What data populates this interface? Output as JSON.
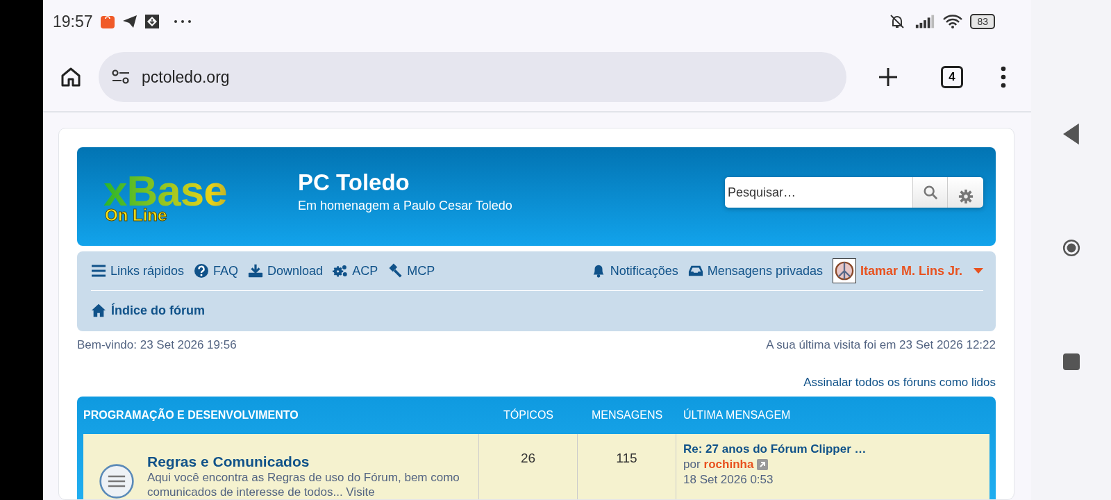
{
  "status_bar": {
    "time": "19:57",
    "battery": "83"
  },
  "browser": {
    "url": "pctoledo.org",
    "tab_count": "4"
  },
  "header": {
    "logo_main": "xBase",
    "logo_sub": "On Line",
    "site_title": "PC Toledo",
    "site_description": "Em homenagem a Paulo Cesar Toledo",
    "search": {
      "placeholder": "Pesquisar…"
    }
  },
  "nav": {
    "left": [
      {
        "label": "Links rápidos"
      },
      {
        "label": "FAQ"
      },
      {
        "label": "Download"
      },
      {
        "label": "ACP"
      },
      {
        "label": "MCP"
      }
    ],
    "right": [
      {
        "label": "Notificações"
      },
      {
        "label": "Mensagens privadas"
      }
    ],
    "user": {
      "name": "Itamar M. Lins Jr."
    },
    "breadcrumb": "Índice do fórum"
  },
  "welcome": "Bem-vindo: 23 Set 2026 19:56",
  "last_visit": "A sua última visita foi em 23 Set 2026 12:22",
  "mark_read": "Assinalar todos os fóruns como lidos",
  "forum_table": {
    "columns": [
      "PROGRAMAÇÃO E DESENVOLVIMENTO",
      "TÓPICOS",
      "MENSAGENS",
      "ÚLTIMA MENSAGEM"
    ],
    "rows": [
      {
        "title": "Regras e Comunicados",
        "description": "Aqui você encontra as Regras de uso do Fórum, bem como comunicados de interesse de todos... Visite",
        "topics": "26",
        "posts": "115",
        "last_post": {
          "title": "Re: 27 anos do Fórum Clipper …",
          "by": "por",
          "author": "rochinha",
          "date": "18 Set 2026 0:53"
        }
      }
    ]
  }
}
